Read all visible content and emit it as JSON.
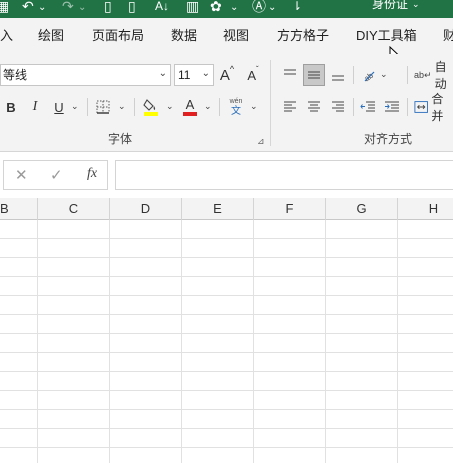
{
  "titlebar": {
    "title": "身份证",
    "quick_access": {
      "save_icon": "save-icon",
      "undo_icon": "undo-icon",
      "redo_icon": "redo-icon",
      "new_icon": "new-file-icon",
      "sort_icon": "sort-az-icon",
      "chart_icon": "chart-icon",
      "text_icon": "text-box-icon"
    }
  },
  "tabs": [
    "入",
    "绘图",
    "页面布局",
    "数据",
    "视图",
    "方方格子",
    "DIY工具箱",
    "财"
  ],
  "font_group": {
    "font_name": "等线",
    "font_size": "11",
    "grow_label": "A",
    "shrink_label": "A",
    "bold": "B",
    "italic": "I",
    "underline": "U",
    "font_color_label": "A",
    "phonetic_top": "wén",
    "phonetic_bottom": "文",
    "label": "字体",
    "fill_color": "#ffff00",
    "text_color": "#e02020"
  },
  "alignment_group": {
    "wrap_label": "自动",
    "merge_label": "合并",
    "label": "对齐方式",
    "orientation_glyph": "ab"
  },
  "formula_bar": {
    "cancel": "✕",
    "enter": "✓",
    "fx": "fx",
    "value": ""
  },
  "columns": [
    "B",
    "C",
    "D",
    "E",
    "F",
    "G",
    "H"
  ]
}
